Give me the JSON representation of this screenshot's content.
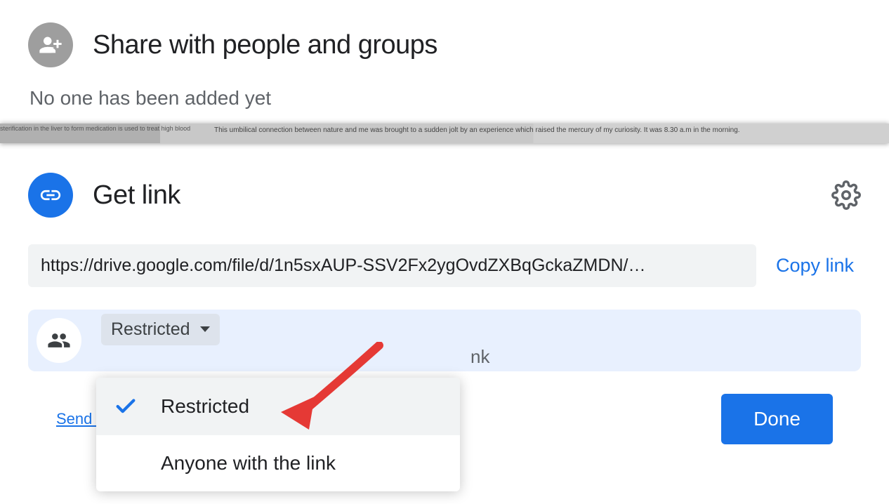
{
  "share": {
    "title": "Share with people and groups",
    "subtitle": "No one has been added yet"
  },
  "doc_strip": {
    "text1": "sterification in the liver to form\nmedication is used to treat high blood",
    "text2": "This umbilical connection between nature and me was brought to a sudden jolt by an\nexperience which raised the mercury of my curiosity. It was 8.30 a.m in the morning."
  },
  "link": {
    "title": "Get link",
    "url": "https://drive.google.com/file/d/1n5sxAUP-SSV2Fx2ygOvdZXBqGckaZMDN/…",
    "copy_label": "Copy link"
  },
  "access": {
    "selected_label": "Restricted",
    "partial_text": "nk",
    "options": [
      {
        "label": "Restricted",
        "selected": true
      },
      {
        "label": "Anyone with the link",
        "selected": false
      }
    ]
  },
  "footer": {
    "feedback_label": "Send feed",
    "done_label": "Done"
  },
  "colors": {
    "primary": "#1a73e8",
    "grey_icon": "#9e9e9e",
    "text_primary": "#202124",
    "text_secondary": "#5f6368",
    "highlight_bg": "#e8f0fe"
  }
}
